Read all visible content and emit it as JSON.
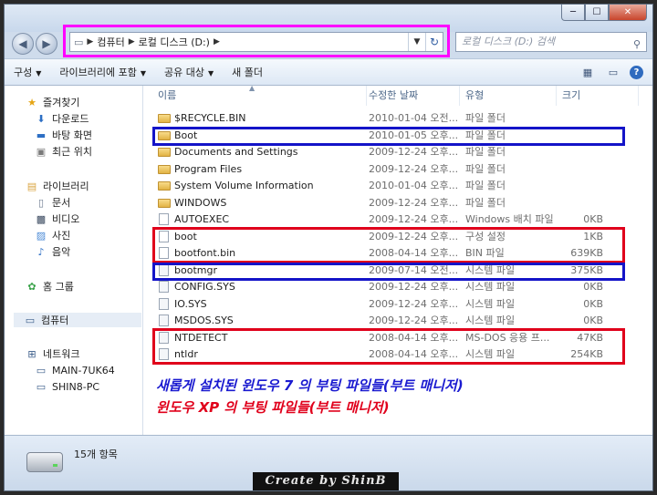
{
  "window": {
    "controls": {
      "minimize": "─",
      "maximize": "☐",
      "close": "✕"
    }
  },
  "navigation": {
    "back_icon": "◀",
    "forward_icon": "▶",
    "breadcrumb": [
      "컴퓨터",
      "로컬 디스크 (D:)"
    ],
    "address_dropdown": "▼",
    "refresh_icon": "↻",
    "search_placeholder": "로컬 디스크 (D:) 검색",
    "search_icon": "⚲"
  },
  "toolbar": {
    "organize": "구성",
    "include_library": "라이브러리에 포함",
    "share_with": "공유 대상",
    "new_folder": "새 폴더",
    "view_icon": "▦",
    "preview_icon": "▭",
    "help_icon": "?"
  },
  "sidebar": {
    "favorites": {
      "label": "즐겨찾기",
      "items": [
        "다운로드",
        "바탕 화면",
        "최근 위치"
      ]
    },
    "libraries": {
      "label": "라이브러리",
      "items": [
        "문서",
        "비디오",
        "사진",
        "음악"
      ]
    },
    "homegroup": "홈 그룹",
    "computer": "컴퓨터",
    "network": {
      "label": "네트워크",
      "items": [
        "MAIN-7UK64",
        "SHIN8-PC"
      ]
    }
  },
  "columns": {
    "name": "이름",
    "modified": "수정한 날짜",
    "type": "유형",
    "size": "크기"
  },
  "files": [
    {
      "name": "$RECYCLE.BIN",
      "date": "2010-01-04 오전...",
      "type": "파일 폴더",
      "size": "",
      "kind": "folder"
    },
    {
      "name": "Boot",
      "date": "2010-01-05 오후...",
      "type": "파일 폴더",
      "size": "",
      "kind": "folder"
    },
    {
      "name": "Documents and Settings",
      "date": "2009-12-24 오후...",
      "type": "파일 폴더",
      "size": "",
      "kind": "folder"
    },
    {
      "name": "Program Files",
      "date": "2009-12-24 오후...",
      "type": "파일 폴더",
      "size": "",
      "kind": "folder"
    },
    {
      "name": "System Volume Information",
      "date": "2010-01-04 오후...",
      "type": "파일 폴더",
      "size": "",
      "kind": "folder"
    },
    {
      "name": "WINDOWS",
      "date": "2009-12-24 오후...",
      "type": "파일 폴더",
      "size": "",
      "kind": "folder"
    },
    {
      "name": "AUTOEXEC",
      "date": "2009-12-24 오후...",
      "type": "Windows 배치 파일",
      "size": "0KB",
      "kind": "file"
    },
    {
      "name": "boot",
      "date": "2009-12-24 오후...",
      "type": "구성 설정",
      "size": "1KB",
      "kind": "file"
    },
    {
      "name": "bootfont.bin",
      "date": "2008-04-14 오후...",
      "type": "BIN 파일",
      "size": "639KB",
      "kind": "file"
    },
    {
      "name": "bootmgr",
      "date": "2009-07-14 오전...",
      "type": "시스템 파일",
      "size": "375KB",
      "kind": "sys"
    },
    {
      "name": "CONFIG.SYS",
      "date": "2009-12-24 오후...",
      "type": "시스템 파일",
      "size": "0KB",
      "kind": "sys"
    },
    {
      "name": "IO.SYS",
      "date": "2009-12-24 오후...",
      "type": "시스템 파일",
      "size": "0KB",
      "kind": "sys"
    },
    {
      "name": "MSDOS.SYS",
      "date": "2009-12-24 오후...",
      "type": "시스템 파일",
      "size": "0KB",
      "kind": "sys"
    },
    {
      "name": "NTDETECT",
      "date": "2008-04-14 오후...",
      "type": "MS-DOS 응용 프...",
      "size": "47KB",
      "kind": "sys"
    },
    {
      "name": "ntldr",
      "date": "2008-04-14 오후...",
      "type": "시스템 파일",
      "size": "254KB",
      "kind": "sys"
    }
  ],
  "annotations": {
    "blue_note": "새롭게 설치된 윈도우 7 의 부팅 파일들(부트 매니저)",
    "red_note": "윈도우 XP 의 부팅 파일들(부트 매니저)",
    "blue_color": "#1414c8",
    "red_color": "#e0001b",
    "magenta_color": "#ff00ff"
  },
  "status": {
    "item_count": "15개 항목",
    "credit": "Create by ShinB"
  }
}
